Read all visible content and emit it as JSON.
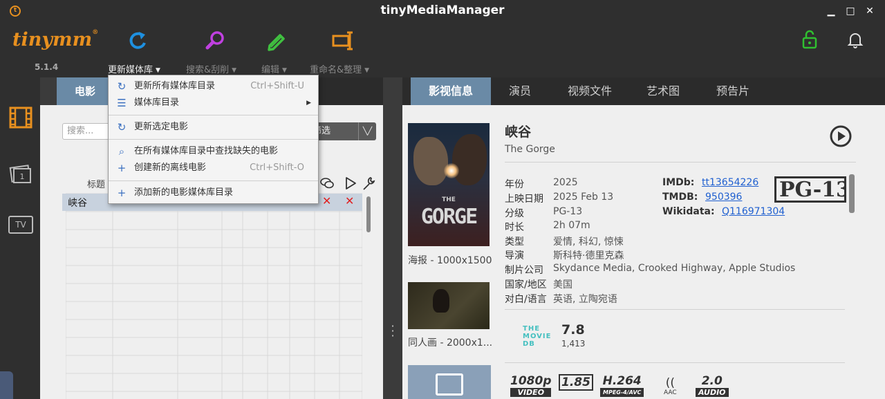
{
  "window": {
    "title": "tinyMediaManager",
    "minimize": "▁",
    "maximize": "□",
    "close": "✕"
  },
  "toolbar": {
    "brand": "tinymm",
    "brand_mark": "®",
    "version": "5.1.4",
    "update_label": "更新媒体库",
    "search_label": "搜索&刮削",
    "edit_label": "编辑",
    "rename_label": "重命名&整理",
    "icons": [
      "refresh-icon",
      "search-scrape-icon",
      "edit-icon",
      "rename-icon",
      "unlock-icon",
      "bell-icon"
    ],
    "colors": {
      "brand": "#e8901f",
      "refresh": "#1e90e0",
      "search": "#c040e0",
      "edit": "#40c040",
      "rename": "#e8901f",
      "unlock": "#30c030"
    }
  },
  "dropdown": {
    "items": [
      {
        "icon": "refresh-icon",
        "label": "更新所有媒体库目录",
        "shortcut": "Ctrl+Shift-U"
      },
      {
        "icon": "list-icon",
        "label": "媒体库目录",
        "submenu": "▶"
      },
      {
        "icon": "refresh-icon",
        "label": "更新选定电影"
      },
      {
        "icon": "search-icon",
        "label": "在所有媒体库目录中查找缺失的电影"
      },
      {
        "icon": "plus-icon",
        "label": "创建新的离线电影",
        "shortcut": "Ctrl+Shift-O"
      },
      {
        "icon": "plus-icon",
        "label": "添加新的电影媒体库目录"
      }
    ]
  },
  "left_panel": {
    "tab": "电影",
    "search_placeholder": "搜索...",
    "filter_label": "筛选",
    "column_title": "标题",
    "row_title": "峡谷",
    "row_marks": [
      "✕",
      "✕"
    ]
  },
  "right_panel": {
    "tabs": [
      "影视信息",
      "演员",
      "视频文件",
      "艺术图",
      "预告片"
    ],
    "title": "峡谷",
    "original_title": "The Gorge",
    "poster_caption": "海报 - 1000x1500",
    "poster_title": "GORGE",
    "poster_the": "THE",
    "fanart_caption": "同人画 - 2000x1...",
    "details": [
      {
        "label": "年份",
        "value": "2025"
      },
      {
        "label": "上映日期",
        "value": "2025 Feb 13"
      },
      {
        "label": "分级",
        "value": "PG-13"
      },
      {
        "label": "时长",
        "value": "2h 07m"
      },
      {
        "label": "类型",
        "value": "爱情, 科幻, 惊悚"
      },
      {
        "label": "导演",
        "value": "斯科特·德里克森"
      },
      {
        "label": "制片公司",
        "value": "Skydance Media, Crooked Highway, Apple Studios"
      },
      {
        "label": "国家/地区",
        "value": "美国"
      },
      {
        "label": "对白/语言",
        "value": "英语, 立陶宛语"
      }
    ],
    "ids": [
      {
        "label": "IMDb:",
        "value": "tt13654226"
      },
      {
        "label": "TMDB:",
        "value": "950396"
      },
      {
        "label": "Wikidata:",
        "value": "Q116971304"
      }
    ],
    "rating_badge": "PG-13",
    "tmdb_logo": [
      "THE",
      "MOVIE",
      "DB"
    ],
    "tmdb_score": "7.8",
    "tmdb_votes": "1,413",
    "media": {
      "resolution": "1080p",
      "resolution_sub": "VIDEO",
      "aspect": "1.85",
      "codec": "H.264",
      "codec_sub": "MPEG-4/AVC",
      "audio_codec": "AAC",
      "channels": "2.0",
      "channels_sub": "AUDIO"
    }
  },
  "sidebar": {
    "items": [
      "movies-icon",
      "movie-sets-icon",
      "tv-shows-icon"
    ],
    "tv_label": "TV",
    "sets_label": "1"
  }
}
